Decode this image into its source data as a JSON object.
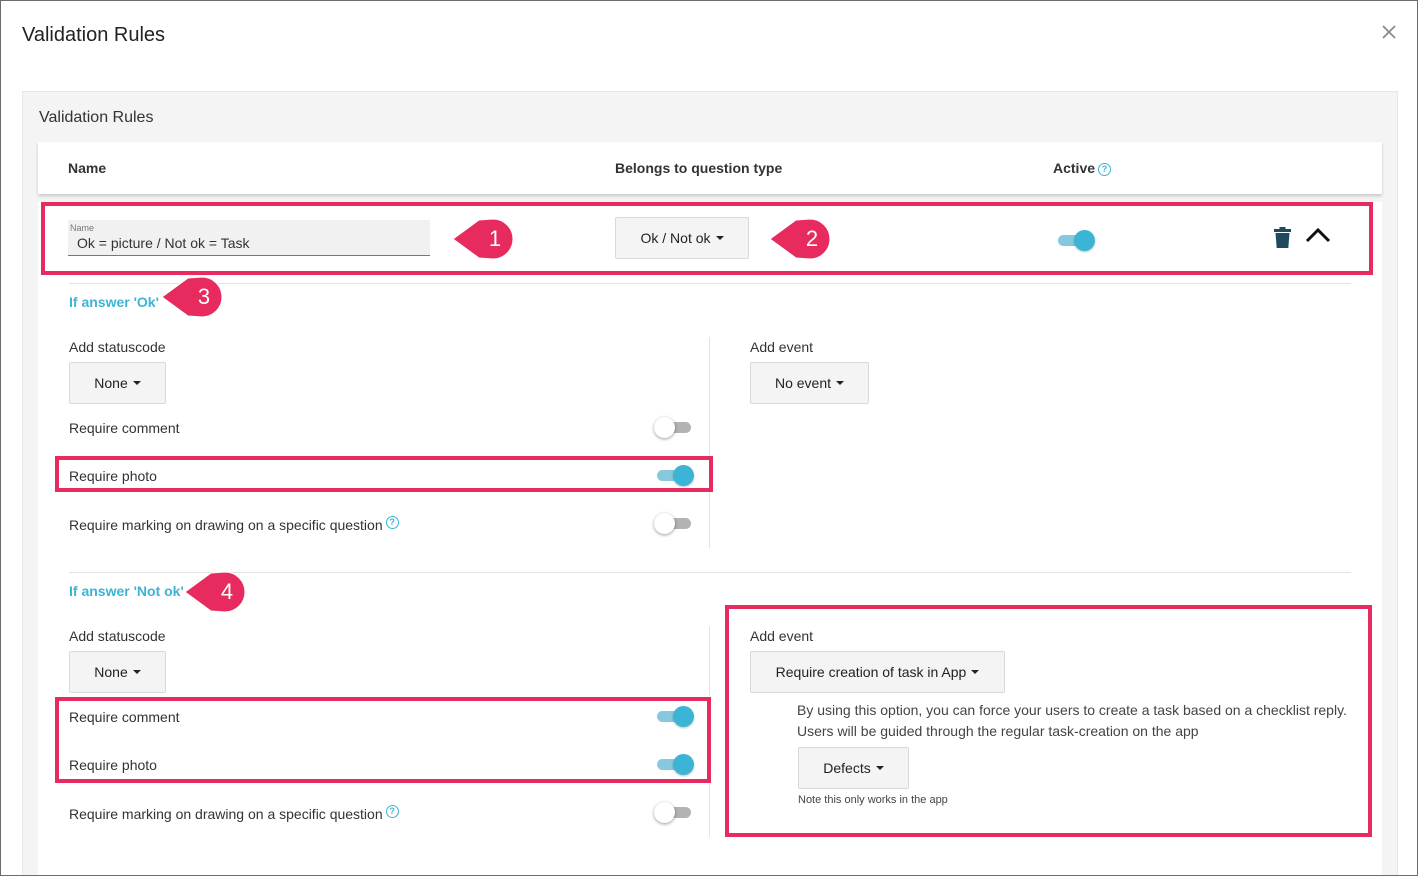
{
  "modal": {
    "title": "Validation Rules"
  },
  "panel": {
    "title": "Validation Rules",
    "columns": {
      "name": "Name",
      "question_type": "Belongs to question type",
      "active": "Active"
    }
  },
  "rule": {
    "name_label": "Name",
    "name_value": "Ok = picture / Not ok = Task",
    "question_type": "Ok / Not ok",
    "active": true
  },
  "answer_ok": {
    "title": "If answer 'Ok'",
    "statuscode_label": "Add statuscode",
    "statuscode_value": "None",
    "event_label": "Add event",
    "event_value": "No event",
    "require_comment_label": "Require comment",
    "require_comment": false,
    "require_photo_label": "Require photo",
    "require_photo": true,
    "require_marking_label": "Require marking on drawing on a specific question",
    "require_marking": false
  },
  "answer_not_ok": {
    "title": "If answer 'Not ok'",
    "statuscode_label": "Add statuscode",
    "statuscode_value": "None",
    "event_label": "Add event",
    "event_value": "Require creation of task in App",
    "event_description_1": "By using this option, you can force your users to create a task based on a checklist reply.",
    "event_description_2": "Users will be guided through the regular task-creation on the app",
    "task_type_value": "Defects",
    "note": "Note this only works in the app",
    "require_comment_label": "Require comment",
    "require_comment": true,
    "require_photo_label": "Require photo",
    "require_photo": true,
    "require_marking_label": "Require marking on drawing on a specific question",
    "require_marking": false
  },
  "callouts": [
    "1",
    "2",
    "3",
    "4"
  ],
  "colors": {
    "accent": "#3cb4d6",
    "highlight": "#e82b5e",
    "icon_dark": "#1d4a5c"
  }
}
